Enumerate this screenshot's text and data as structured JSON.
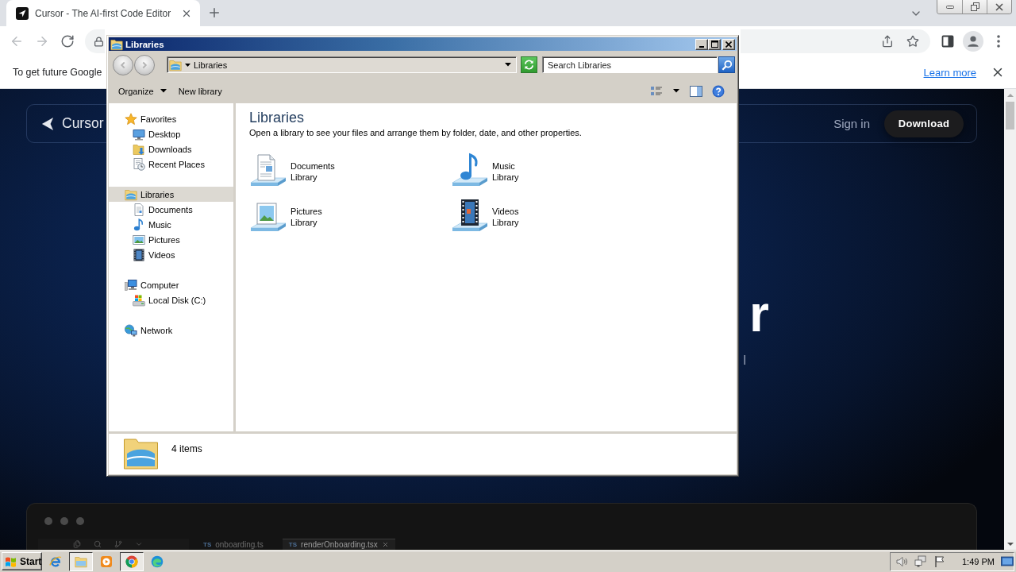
{
  "browser": {
    "tab": {
      "title": "Cursor - The AI-first Code Editor"
    },
    "nav_buttons": [
      {
        "kind": "back",
        "disabled": true
      },
      {
        "kind": "forward",
        "disabled": true
      },
      {
        "kind": "reload",
        "disabled": false
      }
    ],
    "infobar": {
      "message": "To get future Google",
      "link": "Learn more"
    }
  },
  "page": {
    "nav": {
      "logo": "Cursor",
      "sign_in": "Sign in",
      "download": "Download"
    },
    "headline": "r",
    "subtitle": "I",
    "editor": {
      "tabs": [
        {
          "prefix": "TS",
          "label": "onboarding.ts",
          "selected": false
        },
        {
          "prefix": "TS",
          "label": "renderOnboarding.tsx",
          "selected": true
        }
      ]
    }
  },
  "explorer": {
    "title": "Libraries",
    "nav_buttons": [
      {
        "kind": "back",
        "disabled": true
      },
      {
        "kind": "forward",
        "disabled": true
      }
    ],
    "address": "Libraries",
    "search": {
      "placeholder": "Search Libraries"
    },
    "commands": [
      {
        "label": "Organize",
        "dropdown": true
      },
      {
        "label": "New library",
        "dropdown": false
      }
    ],
    "nav": [
      {
        "label": "Favorites",
        "kind": "favorites",
        "selected": false,
        "children": [
          {
            "label": "Desktop",
            "kind": "desktop",
            "selected": false
          },
          {
            "label": "Downloads",
            "kind": "downloads",
            "selected": false
          },
          {
            "label": "Recent Places",
            "kind": "recent",
            "selected": false
          }
        ]
      },
      {
        "label": "Libraries",
        "kind": "libraries",
        "selected": true,
        "children": [
          {
            "label": "Documents",
            "kind": "documents",
            "selected": false
          },
          {
            "label": "Music",
            "kind": "music",
            "selected": false
          },
          {
            "label": "Pictures",
            "kind": "pictures",
            "selected": false
          },
          {
            "label": "Videos",
            "kind": "videos",
            "selected": false
          }
        ]
      },
      {
        "label": "Computer",
        "kind": "computer",
        "selected": false,
        "children": [
          {
            "label": "Local Disk (C:)",
            "kind": "disk",
            "selected": false
          }
        ]
      },
      {
        "label": "Network",
        "kind": "network",
        "selected": false
      }
    ],
    "heading": "Libraries",
    "description": "Open a library to see your files and arrange them by folder, date, and other properties.",
    "libraries": [
      {
        "name": "Documents",
        "type": "Library",
        "kind": "documents"
      },
      {
        "name": "Music",
        "type": "Library",
        "kind": "music"
      },
      {
        "name": "Pictures",
        "type": "Library",
        "kind": "pictures"
      },
      {
        "name": "Videos",
        "type": "Library",
        "kind": "videos"
      }
    ],
    "status": "4 items"
  },
  "taskbar": {
    "start": "Start",
    "apps": [
      {
        "kind": "ie",
        "selected": false
      },
      {
        "kind": "explorer",
        "selected": true
      },
      {
        "kind": "media",
        "selected": false
      },
      {
        "kind": "chrome",
        "selected": true
      },
      {
        "kind": "edge",
        "selected": false
      }
    ],
    "clock": "1:49 PM"
  }
}
